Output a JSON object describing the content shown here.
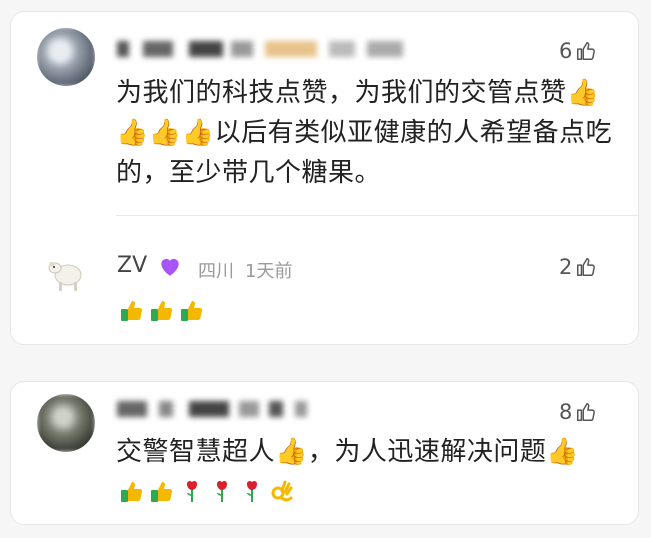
{
  "comments": [
    {
      "likes": "6",
      "text": "为我们的科技点赞，为我们的交管点赞👍👍👍👍以后有类似亚健康的人希望备点吃的，至少带几个糖果。",
      "replies": [
        {
          "name": "ZV",
          "location": "四川",
          "time": "1天前",
          "likes": "2",
          "emojis": [
            "thumbs-up",
            "thumbs-up",
            "thumbs-up"
          ]
        }
      ]
    },
    {
      "likes": "8",
      "text": "交警智慧超人👍，为人迅速解决问题👍",
      "emojis": [
        "thumbs-up",
        "thumbs-up",
        "rose",
        "rose",
        "rose",
        "ok-hand"
      ]
    }
  ],
  "colors": {
    "background": "#f6f6f6",
    "card": "#ffffff",
    "text": "#222222",
    "meta": "#9a9a9a",
    "heart": "#a855f7",
    "thumb": "#f5b800",
    "sleeve": "#2fa84f"
  }
}
